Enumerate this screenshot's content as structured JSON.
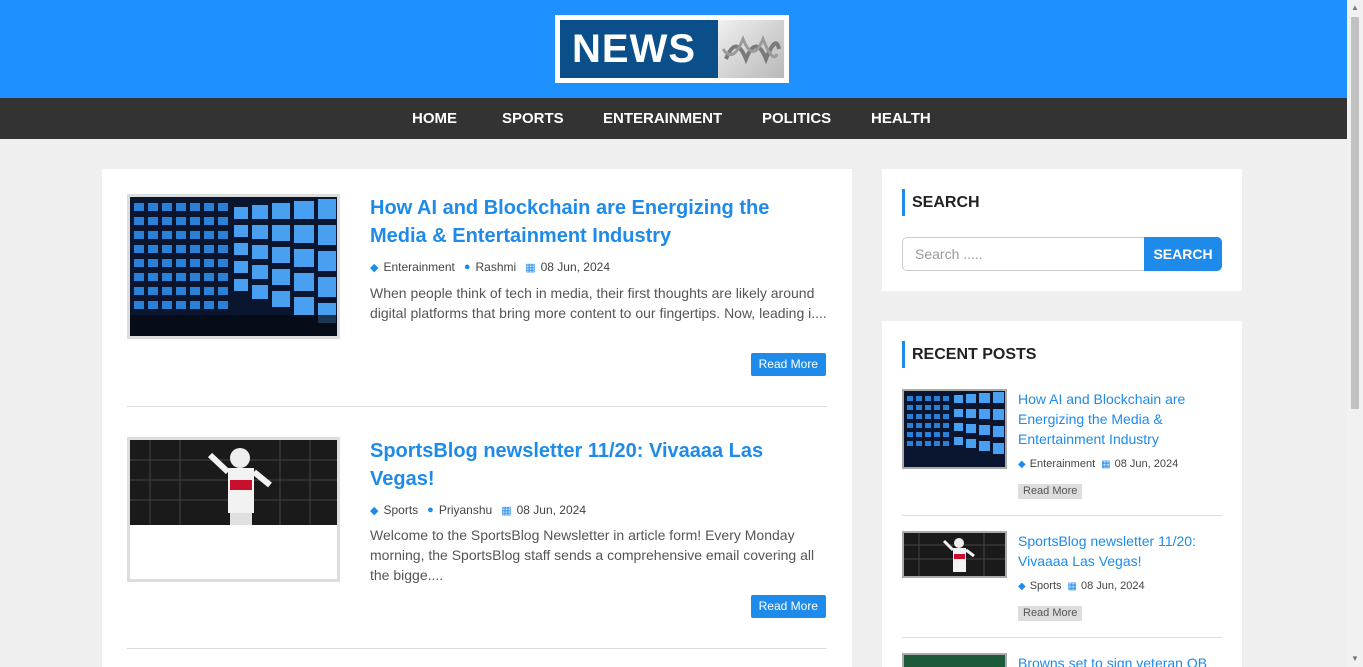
{
  "logo": {
    "text": "NEWS"
  },
  "nav": {
    "items": [
      {
        "label": "HOME"
      },
      {
        "label": "SPORTS"
      },
      {
        "label": "ENTERAINMENT"
      },
      {
        "label": "POLITICS"
      },
      {
        "label": "HEALTH"
      }
    ]
  },
  "posts": [
    {
      "title": "How AI and Blockchain are Energizing the Media & Entertainment Industry",
      "category": "Enterainment",
      "author": "Rashmi",
      "date": "08 Jun, 2024",
      "excerpt": "When people think of tech in media, their first thoughts are likely around digital platforms that bring more content to our fingertips. Now, leading i....",
      "read_more": "Read More"
    },
    {
      "title": "SportsBlog newsletter 11/20: Vivaaaa Las Vegas!",
      "category": "Sports",
      "author": "Priyanshu",
      "date": "08 Jun, 2024",
      "excerpt": "Welcome to the SportsBlog Newsletter in article form! Every Monday morning, the SportsBlog staff sends a comprehensive email covering all the bigge....",
      "read_more": "Read More"
    }
  ],
  "search": {
    "title": "SEARCH",
    "placeholder": "Search .....",
    "button": "SEARCH"
  },
  "recent": {
    "title": "RECENT POSTS",
    "items": [
      {
        "title": "How AI and Blockchain are Energizing the Media & Entertainment Industry",
        "category": "Enterainment",
        "date": "08 Jun, 2024",
        "read_more": "Read More"
      },
      {
        "title": "SportsBlog newsletter 11/20: Vivaaaa Las Vegas!",
        "category": "Sports",
        "date": "08 Jun, 2024",
        "read_more": "Read More"
      },
      {
        "title": "Browns set to sign veteran QB"
      }
    ]
  },
  "colors": {
    "header": "#1e90ff",
    "nav": "#333333",
    "accent": "#1e8bea",
    "background": "#efefef"
  }
}
